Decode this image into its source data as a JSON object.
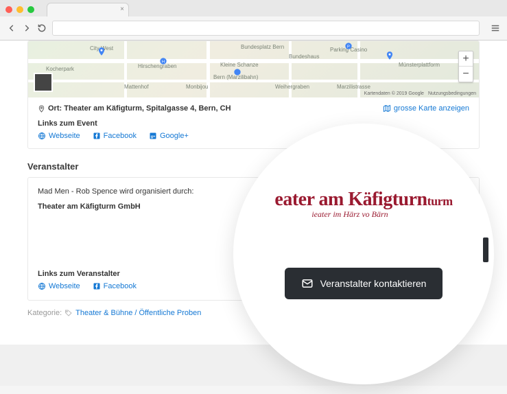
{
  "map": {
    "labels": {
      "kocherpark": "Kocherpark",
      "citywest": "City West",
      "hirschengraben": "Hirschengraben",
      "bundesplatz": "Bundesplatz Bern",
      "marzili": "Bern (Marzilibahn)",
      "bundeshaus": "Bundeshaus",
      "parking": "Parking Casino",
      "kleine": "Kleine Schanze",
      "munster": "Münsterplattform",
      "mattenhof": "Mattenhof",
      "monbijou": "Monbijou",
      "weihergraben": "Weihergraben",
      "marzilistr": "Marzilistrasse"
    },
    "attribution": {
      "data": "Kartendaten © 2019 Google",
      "terms": "Nutzungsbedingungen"
    }
  },
  "location": {
    "prefix": "Ort:",
    "address": "Theater am Käfigturm, Spitalgasse 4, Bern, CH",
    "large_map": "grosse Karte anzeigen",
    "links_heading": "Links zum Event",
    "links": {
      "website": "Webseite",
      "facebook": "Facebook",
      "googleplus": "Google+"
    }
  },
  "organizer": {
    "heading": "Veranstalter",
    "intro": "Mad Men - Rob Spence wird organisiert durch:",
    "name": "Theater am Käfigturm GmbH",
    "logo": {
      "line1a": "eater am Käfigturn",
      "line1b": "turm",
      "line2": "ieater im Härz vo Bärn"
    },
    "links_heading": "Links zum Veranstalter",
    "links": {
      "website": "Webseite",
      "facebook": "Facebook"
    },
    "contact_button": "Veranstalter kontaktieren"
  },
  "category": {
    "label": "Kategorie:",
    "value": "Theater & Bühne / Öffentliche Proben"
  }
}
